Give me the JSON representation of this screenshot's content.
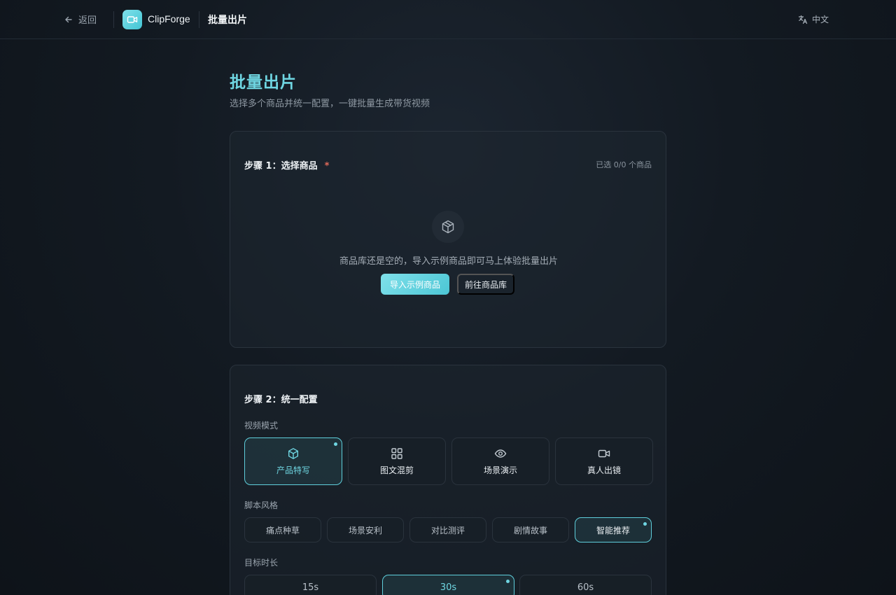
{
  "header": {
    "back_label": "返回",
    "brand": "ClipForge",
    "page": "批量出片",
    "language": "中文"
  },
  "page": {
    "title": "批量出片",
    "subtitle": "选择多个商品并统一配置，一键批量生成带货视频"
  },
  "step1": {
    "title": "步骤 1：选择商品",
    "required_mark": "*",
    "selected_count": "已选 0/0 个商品",
    "empty_text": "商品库还是空的，导入示例商品即可马上体验批量出片",
    "import_button": "导入示例商品",
    "library_button": "前往商品库"
  },
  "step2": {
    "title": "步骤 2：统一配置",
    "video_mode_label": "视频模式",
    "video_modes": [
      {
        "label": "产品特写",
        "icon": "box-icon",
        "selected": true
      },
      {
        "label": "图文混剪",
        "icon": "grid-icon",
        "selected": false
      },
      {
        "label": "场景演示",
        "icon": "eye-icon",
        "selected": false
      },
      {
        "label": "真人出镜",
        "icon": "video-camera-icon",
        "selected": false
      }
    ],
    "script_style_label": "脚本风格",
    "script_styles": [
      {
        "label": "痛点种草",
        "selected": false
      },
      {
        "label": "场景安利",
        "selected": false
      },
      {
        "label": "对比测评",
        "selected": false
      },
      {
        "label": "剧情故事",
        "selected": false
      },
      {
        "label": "智能推荐",
        "selected": true
      }
    ],
    "duration_label": "目标时长",
    "durations": [
      {
        "label": "15s",
        "selected": false
      },
      {
        "label": "30s",
        "selected": true
      },
      {
        "label": "60s",
        "selected": false
      }
    ]
  },
  "colors": {
    "accent": "#6fd6e2",
    "background": "#131a22",
    "required": "#e26a5a"
  }
}
